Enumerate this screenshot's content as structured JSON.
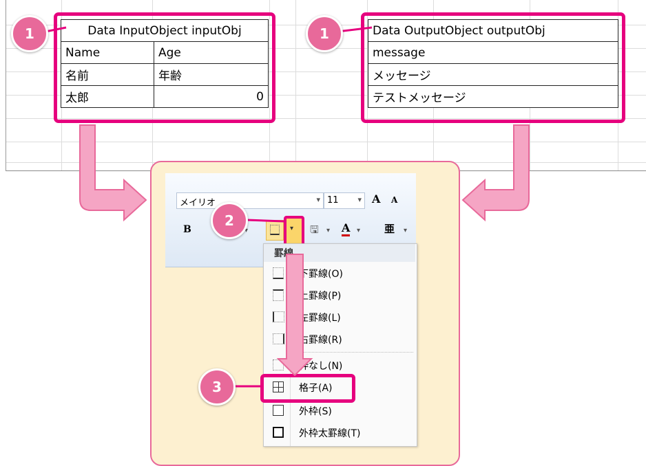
{
  "badges": {
    "step1": "1",
    "step2": "2",
    "step3": "3"
  },
  "input_table": {
    "title": "Data InputObject inputObj",
    "rows": [
      [
        "Name",
        "Age"
      ],
      [
        "名前",
        "年齢"
      ],
      [
        "太郎",
        "0"
      ]
    ]
  },
  "output_table": {
    "title": "Data OutputObject outputObj",
    "rows": [
      "message",
      "メッセージ",
      "テストメッセージ"
    ]
  },
  "ribbon": {
    "font_name": "メイリオ",
    "font_size": "11",
    "bold": "B",
    "increase_font": "A",
    "decrease_font": "A",
    "font_color": "A",
    "phonetic": "亜"
  },
  "borders_menu": {
    "header": "罫線",
    "items": [
      "下罫線(O)",
      "上罫線(P)",
      "左罫線(L)",
      "右罫線(R)",
      "枠なし(N)",
      "格子(A)",
      "外枠(S)",
      "外枠太罫線(T)"
    ]
  },
  "colors": {
    "highlight": "#e6007e",
    "badge": "#e8699a",
    "arrow": "#f5a5c4",
    "panel": "#fdf0d0"
  }
}
